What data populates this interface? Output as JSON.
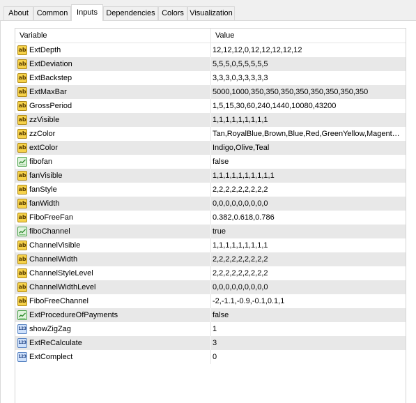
{
  "tabs": [
    {
      "label": "About"
    },
    {
      "label": "Common"
    },
    {
      "label": "Inputs",
      "active": true
    },
    {
      "label": "Dependencies"
    },
    {
      "label": "Colors"
    },
    {
      "label": "Visualization"
    }
  ],
  "grid": {
    "header": {
      "variable": "Variable",
      "value": "Value"
    },
    "rows": [
      {
        "type": "ab",
        "name": "ExtDepth",
        "value": "12,12,12,0,12,12,12,12,12"
      },
      {
        "type": "ab",
        "name": "ExtDeviation",
        "value": "5,5,5,0,5,5,5,5,5"
      },
      {
        "type": "ab",
        "name": "ExtBackstep",
        "value": "3,3,3,0,3,3,3,3,3"
      },
      {
        "type": "ab",
        "name": "ExtMaxBar",
        "value": "5000,1000,350,350,350,350,350,350,350,350"
      },
      {
        "type": "ab",
        "name": "GrossPeriod",
        "value": "1,5,15,30,60,240,1440,10080,43200"
      },
      {
        "type": "ab",
        "name": "zzVisible",
        "value": "1,1,1,1,1,1,1,1,1"
      },
      {
        "type": "ab",
        "name": "zzColor",
        "value": "Tan,RoyalBlue,Brown,Blue,Red,GreenYellow,Magenta,I..."
      },
      {
        "type": "ab",
        "name": "extColor",
        "value": "Indigo,Olive,Teal"
      },
      {
        "type": "bool",
        "name": "fibofan",
        "value": "false"
      },
      {
        "type": "ab",
        "name": "fanVisible",
        "value": "1,1,1,1,1,1,1,1,1,1"
      },
      {
        "type": "ab",
        "name": "fanStyle",
        "value": "2,2,2,2,2,2,2,2,2"
      },
      {
        "type": "ab",
        "name": "fanWidth",
        "value": "0,0,0,0,0,0,0,0,0"
      },
      {
        "type": "ab",
        "name": "FiboFreeFan",
        "value": "0.382,0.618,0.786"
      },
      {
        "type": "bool",
        "name": "fiboChannel",
        "value": "true"
      },
      {
        "type": "ab",
        "name": "ChannelVisible",
        "value": "1,1,1,1,1,1,1,1,1"
      },
      {
        "type": "ab",
        "name": "ChannelWidth",
        "value": "2,2,2,2,2,2,2,2,2"
      },
      {
        "type": "ab",
        "name": "ChannelStyleLevel",
        "value": "2,2,2,2,2,2,2,2,2"
      },
      {
        "type": "ab",
        "name": "ChannelWidthLevel",
        "value": "0,0,0,0,0,0,0,0,0"
      },
      {
        "type": "ab",
        "name": "FiboFreeChannel",
        "value": "-2,-1.1,-0.9,-0.1,0.1,1"
      },
      {
        "type": "bool",
        "name": "ExtProcedureOfPayments",
        "value": "false"
      },
      {
        "type": "num",
        "name": "showZigZag",
        "value": "1"
      },
      {
        "type": "num",
        "name": "ExtReCalculate",
        "value": "3"
      },
      {
        "type": "num",
        "name": "ExtComplect",
        "value": "0"
      }
    ]
  },
  "icons": {
    "ab": {
      "name": "string-type-icon",
      "glyph": "ab"
    },
    "num": {
      "name": "integer-type-icon",
      "glyph": "123"
    },
    "bool": {
      "name": "boolean-type-icon",
      "glyph": ""
    }
  }
}
